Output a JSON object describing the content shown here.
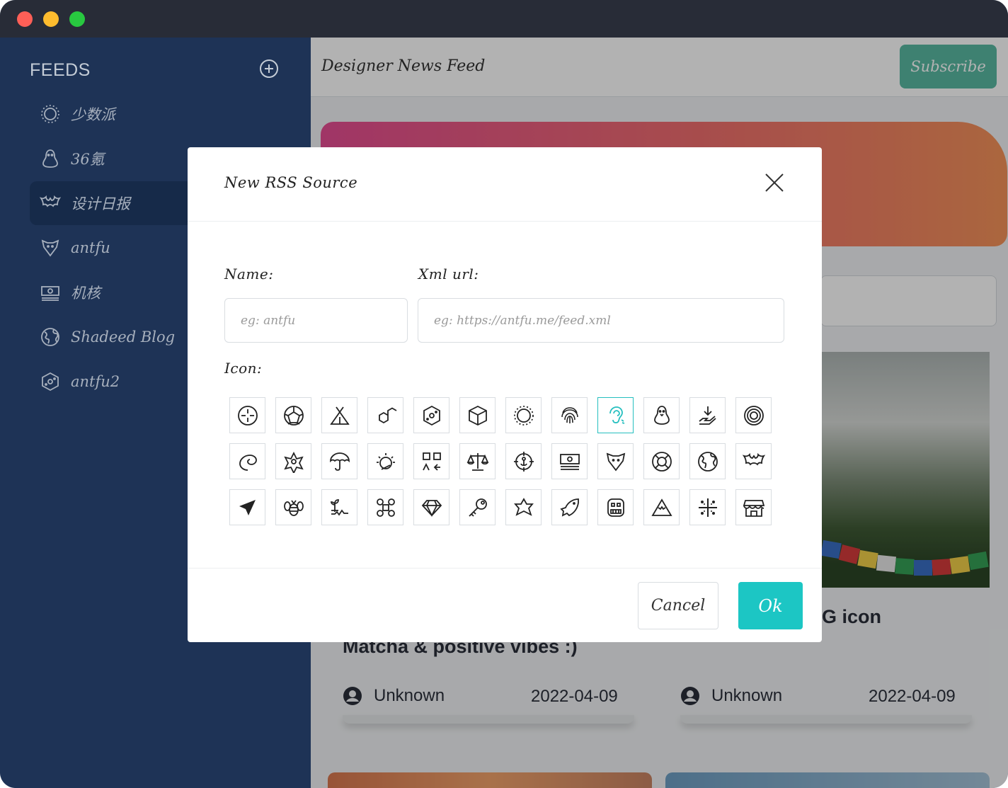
{
  "sidebar": {
    "title": "FEEDS",
    "items": [
      {
        "label": "少数派",
        "icon": "sun-icon"
      },
      {
        "label": "36氪",
        "icon": "penguin-icon"
      },
      {
        "label": "设计日报",
        "icon": "bat-icon",
        "active": true
      },
      {
        "label": "antfu",
        "icon": "fox-icon"
      },
      {
        "label": "机核",
        "icon": "banknote-icon"
      },
      {
        "label": "Shadeed Blog",
        "icon": "globe-icon"
      },
      {
        "label": "antfu2",
        "icon": "hexagon-icon"
      }
    ]
  },
  "header": {
    "title": "Designer News Feed",
    "subscribe_label": "Subscribe"
  },
  "cards": [
    {
      "title": "Matcha & positive vibes :)",
      "author": "Unknown",
      "date": "2022-04-09"
    },
    {
      "title": "G icon",
      "author": "Unknown",
      "date": "2022-04-09"
    }
  ],
  "modal": {
    "title": "New RSS Source",
    "name_label": "Name:",
    "name_placeholder": "eg: antfu",
    "url_label": "Xml url:",
    "url_placeholder": "eg: https://antfu.me/feed.xml",
    "icon_label": "Icon:",
    "cancel_label": "Cancel",
    "ok_label": "Ok",
    "selected_icon": "ear-icon",
    "icons": [
      "crosshair-icon",
      "polyhedron-icon",
      "tent-icon",
      "hexagons-icon",
      "hexagon-dots-icon",
      "cube-icon",
      "sun-icon",
      "fingerprint-icon",
      "ear-icon",
      "penguin-icon",
      "hand-download-icon",
      "spiral-icon",
      "tornado-icon",
      "shuriken-icon",
      "umbrella-icon",
      "sunrise-icon",
      "qr-arrows-icon",
      "scales-icon",
      "anchor-target-icon",
      "banknote-icon",
      "fox-icon",
      "lifebuoy-icon",
      "globe-icon",
      "bat-icon",
      "paper-plane-icon",
      "bee-icon",
      "sprout-icon",
      "drone-icon",
      "diamond-icon",
      "key-icon",
      "star-icon",
      "fish-icon",
      "monster-icon",
      "mountain-icon",
      "dots-grid-icon",
      "store-icon"
    ]
  },
  "colors": {
    "sidebar_bg": "#1e3356",
    "accent_teal": "#1cc6c4",
    "subscribe_green": "#5ab9a3"
  }
}
